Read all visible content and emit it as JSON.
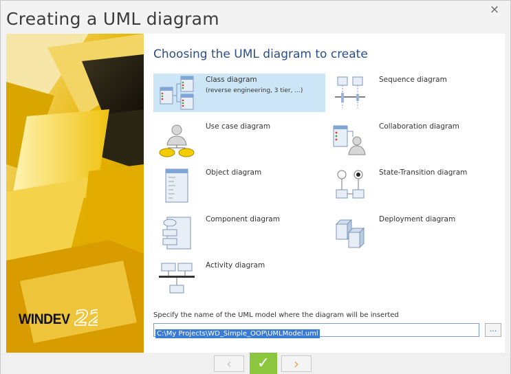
{
  "window": {
    "title": "Creating a UML diagram",
    "close_glyph": "×"
  },
  "sidebar": {
    "logo_text": "WINDEV",
    "logo_version": "22"
  },
  "main": {
    "heading": "Choosing the UML diagram to create",
    "options": [
      {
        "label": "Class diagram",
        "sublabel": "(reverse engineering, 3 tier, ...)",
        "icon": "class-diagram-icon",
        "selected": true
      },
      {
        "label": "Sequence diagram",
        "sublabel": "",
        "icon": "sequence-diagram-icon",
        "selected": false
      },
      {
        "label": "Use case diagram",
        "sublabel": "",
        "icon": "use-case-diagram-icon",
        "selected": false
      },
      {
        "label": "Collaboration diagram",
        "sublabel": "",
        "icon": "collaboration-diagram-icon",
        "selected": false
      },
      {
        "label": "Object diagram",
        "sublabel": "",
        "icon": "object-diagram-icon",
        "selected": false
      },
      {
        "label": "State-Transition diagram",
        "sublabel": "",
        "icon": "state-transition-diagram-icon",
        "selected": false
      },
      {
        "label": "Component diagram",
        "sublabel": "",
        "icon": "component-diagram-icon",
        "selected": false
      },
      {
        "label": "Deployment diagram",
        "sublabel": "",
        "icon": "deployment-diagram-icon",
        "selected": false
      },
      {
        "label": "Activity diagram",
        "sublabel": "",
        "icon": "activity-diagram-icon",
        "selected": false
      }
    ],
    "model": {
      "label": "Specify the name of the UML model where the diagram will be inserted",
      "value": "C:\\My Projects\\WD_Simple_OOP\\UMLModel.uml",
      "browse_label": "..."
    }
  },
  "footer": {
    "prev_glyph": "‹",
    "ok_glyph": "✓",
    "next_glyph": "›"
  },
  "colors": {
    "heading": "#2a4e86",
    "selection": "#cde6f7",
    "ok_button": "#8cc63f",
    "next_arrow": "#f0a23a",
    "sidebar_yellow": "#e8b800"
  }
}
